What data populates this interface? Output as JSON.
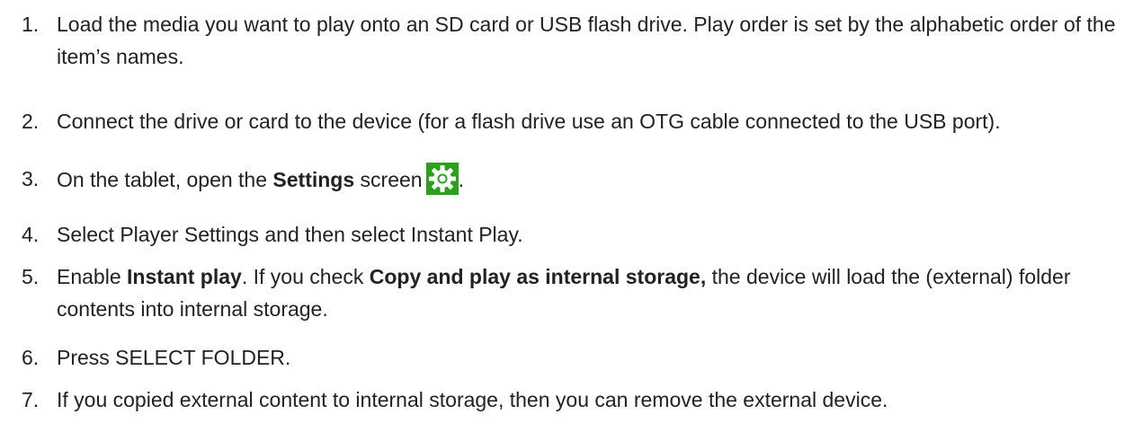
{
  "steps": [
    {
      "number": "1.",
      "text": "Load the media you want to play onto an SD card or USB flash drive. Play order is set by the alphabetic order of the item’s names."
    },
    {
      "number": "2.",
      "text": "Connect the drive or card to the device (for a flash drive use an OTG cable connected to the USB port)."
    },
    {
      "number": "3.",
      "before": "On the tablet, open the ",
      "bold": "Settings",
      "after": " screen",
      "icon": "settings-gear-icon",
      "icon_bg": "#2e9e1f",
      "end": "."
    },
    {
      "number": "4.",
      "text": "Select Player Settings and then select Instant Play."
    },
    {
      "number": "5.",
      "part1": "Enable ",
      "bold1": "Instant play",
      "part2": ". If you check ",
      "bold2": "Copy and play as internal storage,",
      "part3": " the device will load the (external) folder contents into internal storage."
    },
    {
      "number": "6.",
      "text": "Press SELECT FOLDER."
    },
    {
      "number": "7.",
      "text": "If you copied external content to internal storage, then you can remove the external device."
    }
  ]
}
